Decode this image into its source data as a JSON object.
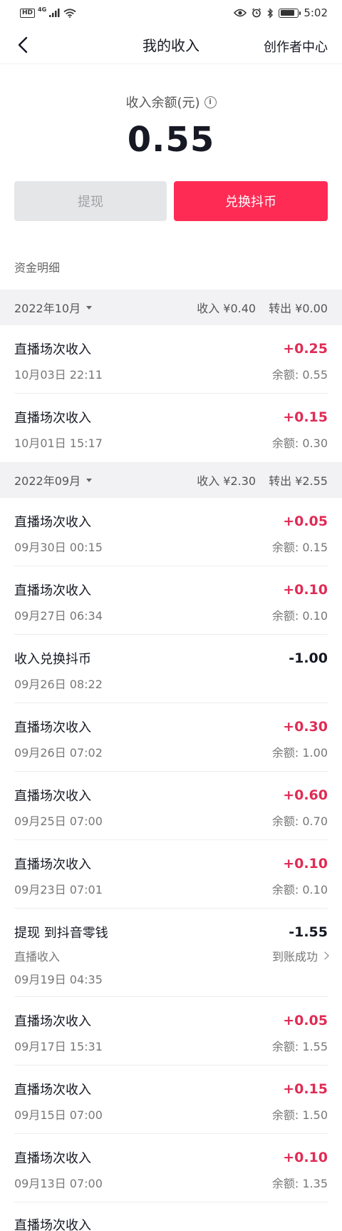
{
  "status_bar": {
    "hd": "HD",
    "net": "4G",
    "time": "5:02",
    "battery_level": 0.85
  },
  "nav": {
    "title": "我的收入",
    "right": "创作者中心"
  },
  "balance": {
    "label": "收入余额(元)",
    "amount": "0.55"
  },
  "actions": {
    "withdraw": "提现",
    "exchange": "兑换抖币"
  },
  "colors": {
    "accent": "#fe2c55",
    "positive": "#e02b55"
  },
  "section_label": "资金明细",
  "months": [
    {
      "month": "2022年10月",
      "income": "收入 ¥0.40",
      "out": "转出 ¥0.00",
      "items": [
        {
          "title": "直播场次收入",
          "time": "10月03日 22:11",
          "amount": "+0.25",
          "balance": "余额: 0.55"
        },
        {
          "title": "直播场次收入",
          "time": "10月01日 15:17",
          "amount": "+0.15",
          "balance": "余额: 0.30"
        }
      ]
    },
    {
      "month": "2022年09月",
      "income": "收入 ¥2.30",
      "out": "转出 ¥2.55",
      "items": [
        {
          "title": "直播场次收入",
          "time": "09月30日 00:15",
          "amount": "+0.05",
          "balance": "余额: 0.15"
        },
        {
          "title": "直播场次收入",
          "time": "09月27日 06:34",
          "amount": "+0.10",
          "balance": "余额: 0.10"
        },
        {
          "title": "收入兑换抖币",
          "time": "09月26日 08:22",
          "amount": "-1.00",
          "balance": ""
        },
        {
          "title": "直播场次收入",
          "time": "09月26日 07:02",
          "amount": "+0.30",
          "balance": "余额: 1.00"
        },
        {
          "title": "直播场次收入",
          "time": "09月25日 07:00",
          "amount": "+0.60",
          "balance": "余额: 0.70"
        },
        {
          "title": "直播场次收入",
          "time": "09月23日 07:01",
          "amount": "+0.10",
          "balance": "余额: 0.10"
        },
        {
          "title": "提现 到抖音零钱",
          "subtitle": "直播收入",
          "status": "到账成功",
          "time": "09月19日 04:35",
          "amount": "-1.55"
        },
        {
          "title": "直播场次收入",
          "time": "09月17日 15:31",
          "amount": "+0.05",
          "balance": "余额: 1.55"
        },
        {
          "title": "直播场次收入",
          "time": "09月15日 07:00",
          "amount": "+0.15",
          "balance": "余额: 1.50"
        },
        {
          "title": "直播场次收入",
          "time": "09月13日 07:00",
          "amount": "+0.10",
          "balance": "余额: 1.35"
        }
      ]
    }
  ],
  "partial_next": "直播场次收入"
}
